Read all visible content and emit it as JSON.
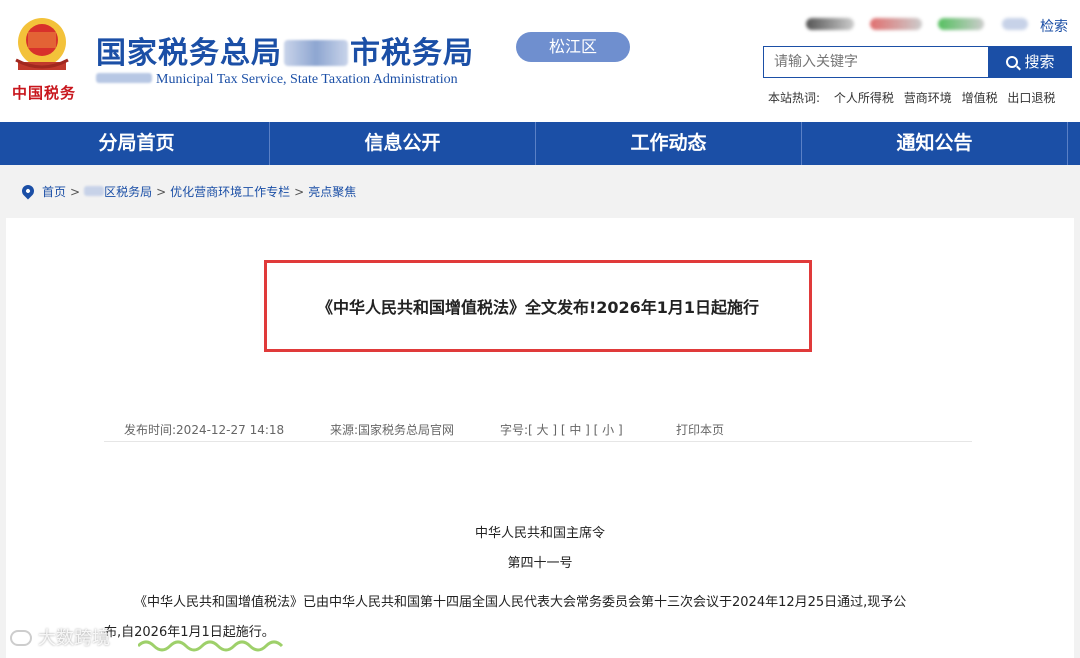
{
  "header": {
    "brand_mark": "中国税务",
    "title_prefix": "国家税务总局",
    "title_suffix": "市税务局",
    "subtitle": "Municipal Tax Service, State Taxation Administration",
    "district": "松江区",
    "top_search_link": "检索",
    "search": {
      "placeholder": "请输入关键字",
      "button": "搜索"
    },
    "hot": {
      "label": "本站热词:",
      "items": [
        "个人所得税",
        "营商环境",
        "增值税",
        "出口退税"
      ]
    }
  },
  "nav": {
    "items": [
      "分局首页",
      "信息公开",
      "工作动态",
      "通知公告"
    ]
  },
  "breadcrumb": {
    "home": "首页",
    "district_suffix": "区税务局",
    "column": "优化营商环境工作专栏",
    "current": "亮点聚焦"
  },
  "article": {
    "title": "《中华人民共和国增值税法》全文发布!2026年1月1日起施行",
    "meta": {
      "publish_time": "发布时间:2024-12-27 14:18",
      "source": "来源:国家税务总局官网",
      "font_size": "字号:[ 大 ] [ 中 ] [ 小 ]",
      "print": "打印本页"
    },
    "heading1": "中华人民共和国主席令",
    "heading2": "第四十一号",
    "para1": "《中华人民共和国增值税法》已由中华人民共和国第十四届全国人民代表大会常务委员会第十三次会议于2024年12月25日通过,现予公",
    "para2": "布,自2026年1月1日起施行。"
  },
  "watermark": "大数跨境",
  "colors": {
    "primary_blue": "#1b4fa6",
    "highlight_red": "#e03a3a",
    "district_pill": "#6f8fcf",
    "page_bg": "#f2f2f2"
  }
}
